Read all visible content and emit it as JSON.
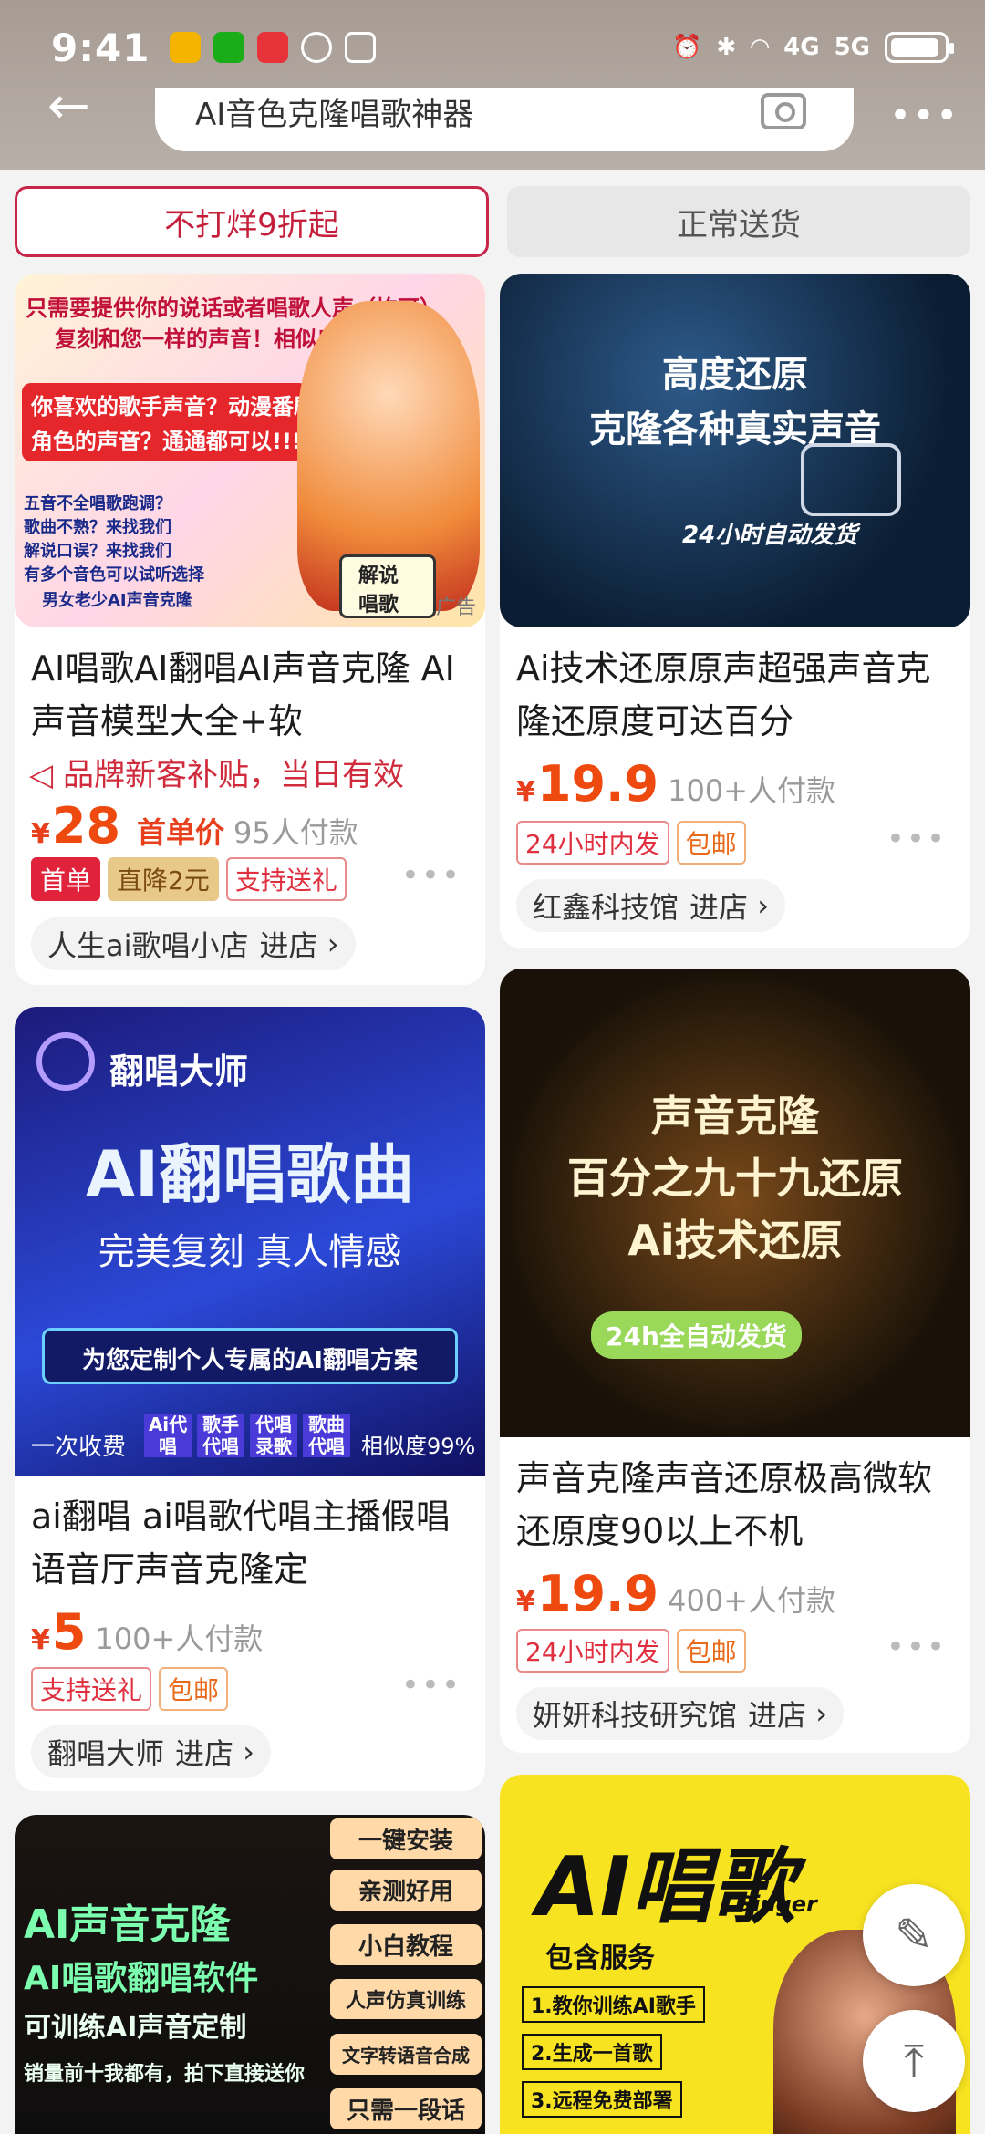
{
  "status": {
    "time": "9:41",
    "net_4g": "4G",
    "net_5g": "5G"
  },
  "search": {
    "query": "AI音色克隆唱歌神器"
  },
  "header": {
    "back": "←",
    "more": "•••"
  },
  "filters": [
    "不打烊9折起",
    "正常送货"
  ],
  "products": [
    {
      "title": "AI唱歌AI翻唱AI声音克隆  AI声音模型大全+软",
      "promo": "品牌新客补贴，当日有效",
      "price": "28",
      "first_label": "首单价",
      "sold": "95人付款",
      "tags": [
        "首单",
        "直降2元",
        "支持送礼"
      ],
      "shop": "人生ai歌唱小店",
      "ad": "广告",
      "img_text": [
        "只需要提供你的说话或者唱歌人声（均可）",
        "复刻和您一样的声音！相似度98%以上！",
        "你喜欢的歌手声音？动漫番剧",
        "角色的声音？通通都可以!!!",
        "五音不全唱歌跑调？",
        "歌曲不熟？来找我们",
        "解说口误？来找我们",
        "有多个音色可以试听选择",
        "男女老少AI声音克隆",
        "解说",
        "唱歌"
      ]
    },
    {
      "title": "Ai技术还原原声超强声音克隆还原度可达百分",
      "price": "19.9",
      "sold": "100+人付款",
      "tags": [
        "24小时内发",
        "包邮"
      ],
      "shop": "红鑫科技馆",
      "img_text": [
        "高度还原",
        "克隆各种真实声音",
        "24小时自动发货"
      ]
    },
    {
      "title": "ai翻唱 ai唱歌代唱主播假唱语音厅声音克隆定",
      "price": "5",
      "sold": "100+人付款",
      "tags": [
        "支持送礼",
        "包邮"
      ],
      "shop": "翻唱大师",
      "img_text": [
        "翻唱大师",
        "AI翻唱歌曲",
        "完美复刻 真人情感",
        "为您定制个人专属的AI翻唱方案",
        "一次收费",
        "Ai代唱",
        "歌手代唱",
        "代唱录歌",
        "歌曲代唱",
        "相似度99%"
      ]
    },
    {
      "title": "声音克隆声音还原极高微软还原度90以上不机",
      "price": "19.9",
      "sold": "400+人付款",
      "tags": [
        "24小时内发",
        "包邮"
      ],
      "shop": "妍妍科技研究馆",
      "img_text": [
        "声音克隆",
        "百分之九十九还原",
        "Ai技术还原",
        "24h全自动发货"
      ]
    },
    {
      "img_text": [
        "AI声音克隆",
        "AI唱歌翻唱软件",
        "可训练AI声音定制",
        "销量前十我都有，拍下直接送你",
        "一键安装",
        "亲测好用",
        "小白教程",
        "人声仿真训练",
        "文字转语音合成",
        "只需一段话"
      ]
    },
    {
      "img_text": [
        "AI唱歌",
        "Singer",
        "包含服务",
        "1.教你训练AI歌手",
        "2.生成一首歌",
        "3.远程免费部署"
      ]
    }
  ],
  "shop_enter": "进店",
  "colors": {
    "accent": "#ee4a10",
    "brand_red": "#c41e3a"
  }
}
